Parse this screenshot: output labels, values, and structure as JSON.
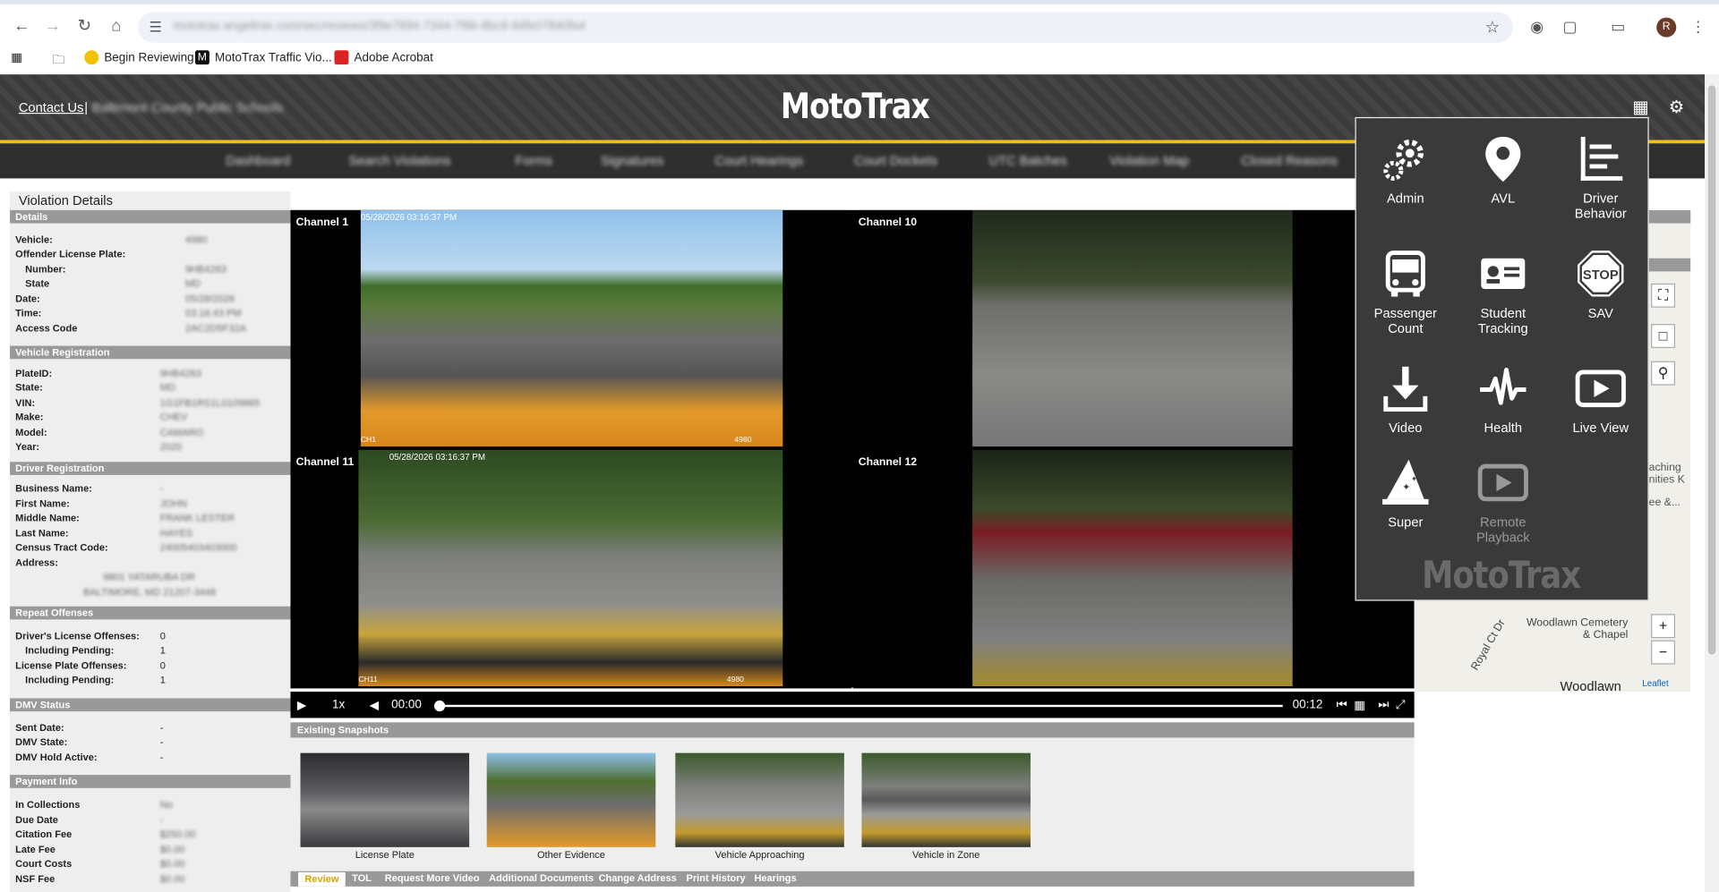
{
  "browser": {
    "url": "mototrax.angeltrax.com/sec/reviews/3f9e7894-7344-7f6b-8bc6-94fe07840fa4",
    "bookmarks": [
      "Begin Reviewing",
      "MotoTrax Traffic Vio...",
      "Adobe Acrobat"
    ],
    "profile_initial": "R"
  },
  "header": {
    "contact": "Contact Us",
    "separator": "|",
    "school": "Baltimore County Public Schools",
    "logo": "MotoTrax"
  },
  "nav": [
    "Dashboard",
    "Search Violations",
    "Forms",
    "Signatures",
    "Court Hearings",
    "Court Dockets",
    "UTC Batches",
    "Violation Map",
    "Closed Reasons"
  ],
  "details": {
    "title": "Violation Details",
    "sections": {
      "details": "Details",
      "vehicle_registration": "Vehicle Registration",
      "driver_registration": "Driver Registration",
      "repeat_offenses": "Repeat Offenses",
      "dmv_status": "DMV Status",
      "payment_info": "Payment Info"
    },
    "labels": {
      "vehicle": "Vehicle:",
      "offender_plate": "Offender License Plate:",
      "number": "Number:",
      "state": "State",
      "date": "Date:",
      "time": "Time:",
      "access_code": "Access Code",
      "plate_id": "PlateID:",
      "vr_state": "State:",
      "vin": "VIN:",
      "make": "Make:",
      "model": "Model:",
      "year": "Year:",
      "business_name": "Business Name:",
      "first_name": "First Name:",
      "middle_name": "Middle Name:",
      "last_name": "Last Name:",
      "census": "Census Tract Code:",
      "address": "Address:",
      "dl_offenses": "Driver's License Offenses:",
      "incl_pending_1": "Including Pending:",
      "lp_offenses": "License Plate Offenses:",
      "incl_pending_2": "Including Pending:",
      "sent_date": "Sent Date:",
      "dmv_state": "DMV State:",
      "dmv_hold": "DMV Hold Active:",
      "in_collections": "In Collections",
      "due_date": "Due Date",
      "citation_fee": "Citation Fee",
      "late_fee": "Late Fee",
      "court_costs": "Court Costs",
      "nsf_fee": "NSF Fee"
    },
    "values": {
      "vehicle": "4980",
      "number": "9HB4283",
      "state": "MD",
      "date": "05/28/2026",
      "time": "03:16:43 PM",
      "access_code": "2AC2D5F32A",
      "plate_id": "9HB4283",
      "vr_state": "MD",
      "vin": "1G1FB1RS1L0109865",
      "make": "CHEV",
      "model": "CAMARO",
      "year": "2020",
      "business_name": "-",
      "first_name": "JOHN",
      "middle_name": "FRANK LESTER",
      "last_name": "HAYES",
      "census": "24005403403000",
      "address_line1": "9801 YATARUBA DR",
      "address_line2": "BALTIMORE, MD 21207-3448",
      "dl_offenses": "0",
      "incl_pending_1": "1",
      "lp_offenses": "0",
      "incl_pending_2": "1",
      "sent_date": "-",
      "dmv_state": "-",
      "dmv_hold": "-",
      "in_collections": "No",
      "due_date": "-",
      "citation_fee": "$250.00",
      "late_fee": "$0.00",
      "court_costs": "$0.00",
      "nsf_fee": "$0.00"
    }
  },
  "channels": [
    {
      "label": "Channel 1",
      "timestamp": "05/28/2026 03:16:37 PM",
      "code": "CH1",
      "unit": "4980"
    },
    {
      "label": "Channel 10",
      "timestamp": "",
      "code": "",
      "unit": ""
    },
    {
      "label": "Channel 11",
      "timestamp": "05/28/2026 03:16:37 PM",
      "code": "CH11",
      "unit": "4980"
    },
    {
      "label": "Channel 12",
      "timestamp": "",
      "code": "",
      "unit": ""
    }
  ],
  "player": {
    "speed": "1x",
    "current": "00:00",
    "duration": "00:12",
    "progress_fraction": 0.0
  },
  "snapshots": {
    "header": "Existing Snapshots",
    "items": [
      "License Plate",
      "Other Evidence",
      "Vehicle Approaching",
      "Vehicle in Zone"
    ]
  },
  "tabs": [
    "Review",
    "TOL",
    "Request More Video",
    "Additional Documents",
    "Change Address",
    "Print History",
    "Hearings"
  ],
  "map": {
    "labels": [
      "Woodlawn Cemetery & Chapel",
      "Woodlawn",
      "Royal Ct Dr",
      "aching nities K",
      "ee &..."
    ],
    "zoom_in": "+",
    "zoom_out": "−",
    "attribution": "Leaflet"
  },
  "menu": {
    "items": [
      {
        "label": "Admin",
        "icon": "gears-icon"
      },
      {
        "label": "AVL",
        "icon": "map-pin-icon"
      },
      {
        "label": "Driver Behavior",
        "icon": "bars-icon"
      },
      {
        "label": "Passenger Count",
        "icon": "bus-icon"
      },
      {
        "label": "Student Tracking",
        "icon": "id-card-icon"
      },
      {
        "label": "SAV",
        "icon": "stop-sign-icon"
      },
      {
        "label": "Video",
        "icon": "download-icon"
      },
      {
        "label": "Health",
        "icon": "pulse-icon"
      },
      {
        "label": "Live View",
        "icon": "play-icon"
      },
      {
        "label": "Super",
        "icon": "wizard-hat-icon"
      },
      {
        "label": "Remote Playback",
        "icon": "play-icon",
        "disabled": true
      }
    ],
    "watermark": "MotoTrax"
  },
  "colors": {
    "accent_yellow": "#f2c200",
    "header_dark": "#3b3b3b",
    "menu_bg": "#3a3a3a"
  }
}
